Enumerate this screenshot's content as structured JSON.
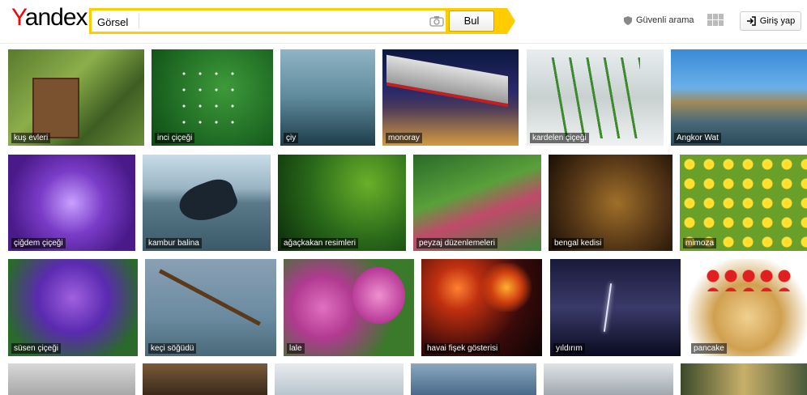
{
  "header": {
    "logo_y": "Y",
    "logo_rest": "andex",
    "search_value": "Görsel",
    "search_button": "Bul",
    "safe_search": "Güvenli arama",
    "login": "Giriş yap"
  },
  "images": [
    {
      "caption": "kuş evleri"
    },
    {
      "caption": "inci çiçeği"
    },
    {
      "caption": "çiy"
    },
    {
      "caption": "monoray"
    },
    {
      "caption": "kardelen çiçeği"
    },
    {
      "caption": "Angkor Wat"
    },
    {
      "caption": "çiğdem çiçeği"
    },
    {
      "caption": "kambur balina"
    },
    {
      "caption": "ağaçkakan resimleri"
    },
    {
      "caption": "peyzaj düzenlemeleri"
    },
    {
      "caption": "bengal kedisi"
    },
    {
      "caption": "mimoza"
    },
    {
      "caption": "süsen çiçeği"
    },
    {
      "caption": "keçi söğüdü"
    },
    {
      "caption": "lale"
    },
    {
      "caption": "havai fişek gösterisi"
    },
    {
      "caption": "yıldırım"
    },
    {
      "caption": "pancake"
    },
    {
      "caption": ""
    },
    {
      "caption": ""
    },
    {
      "caption": ""
    },
    {
      "caption": ""
    },
    {
      "caption": ""
    },
    {
      "caption": ""
    }
  ]
}
